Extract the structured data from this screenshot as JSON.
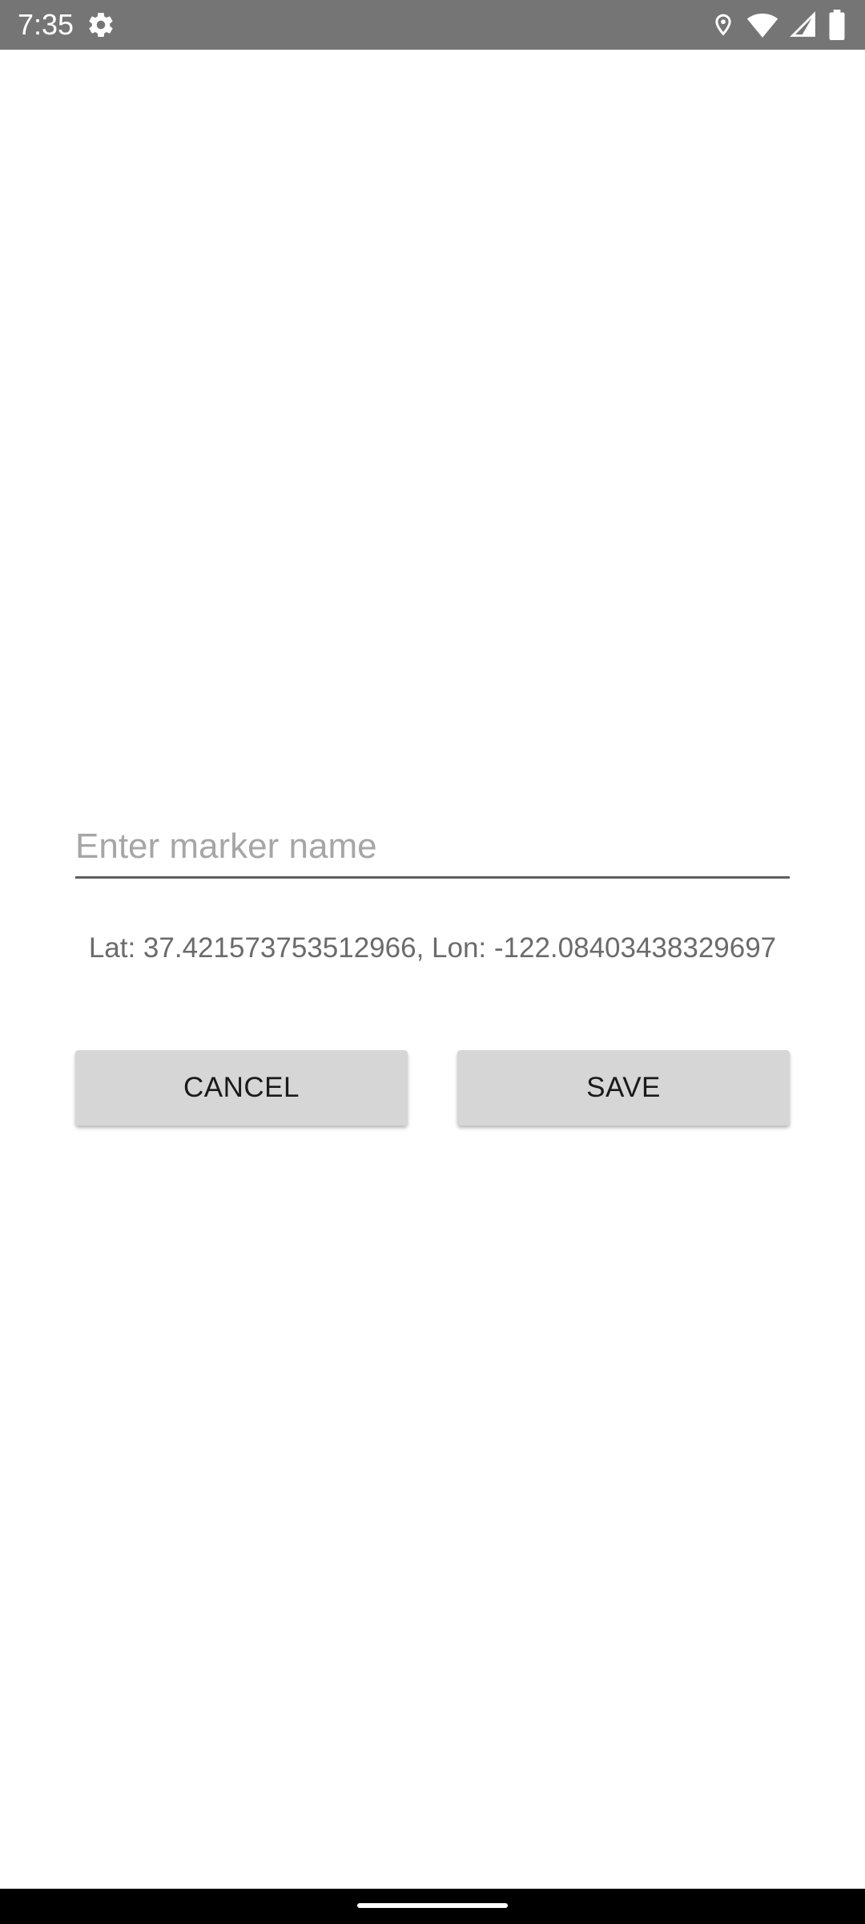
{
  "status_bar": {
    "time": "7:35",
    "icons": [
      "settings-icon",
      "location-icon",
      "wifi-icon",
      "cellular-signal-icon",
      "battery-icon"
    ],
    "background_color": "#757575"
  },
  "form": {
    "name_input": {
      "value": "",
      "placeholder": "Enter marker name"
    },
    "coordinates_text": "Lat: 37.421573753512966, Lon: -122.08403438329697",
    "cancel_label": "CANCEL",
    "save_label": "SAVE",
    "button_color": "#d6d6d6"
  },
  "nav_bar": {
    "handle": "gesture-handle"
  }
}
